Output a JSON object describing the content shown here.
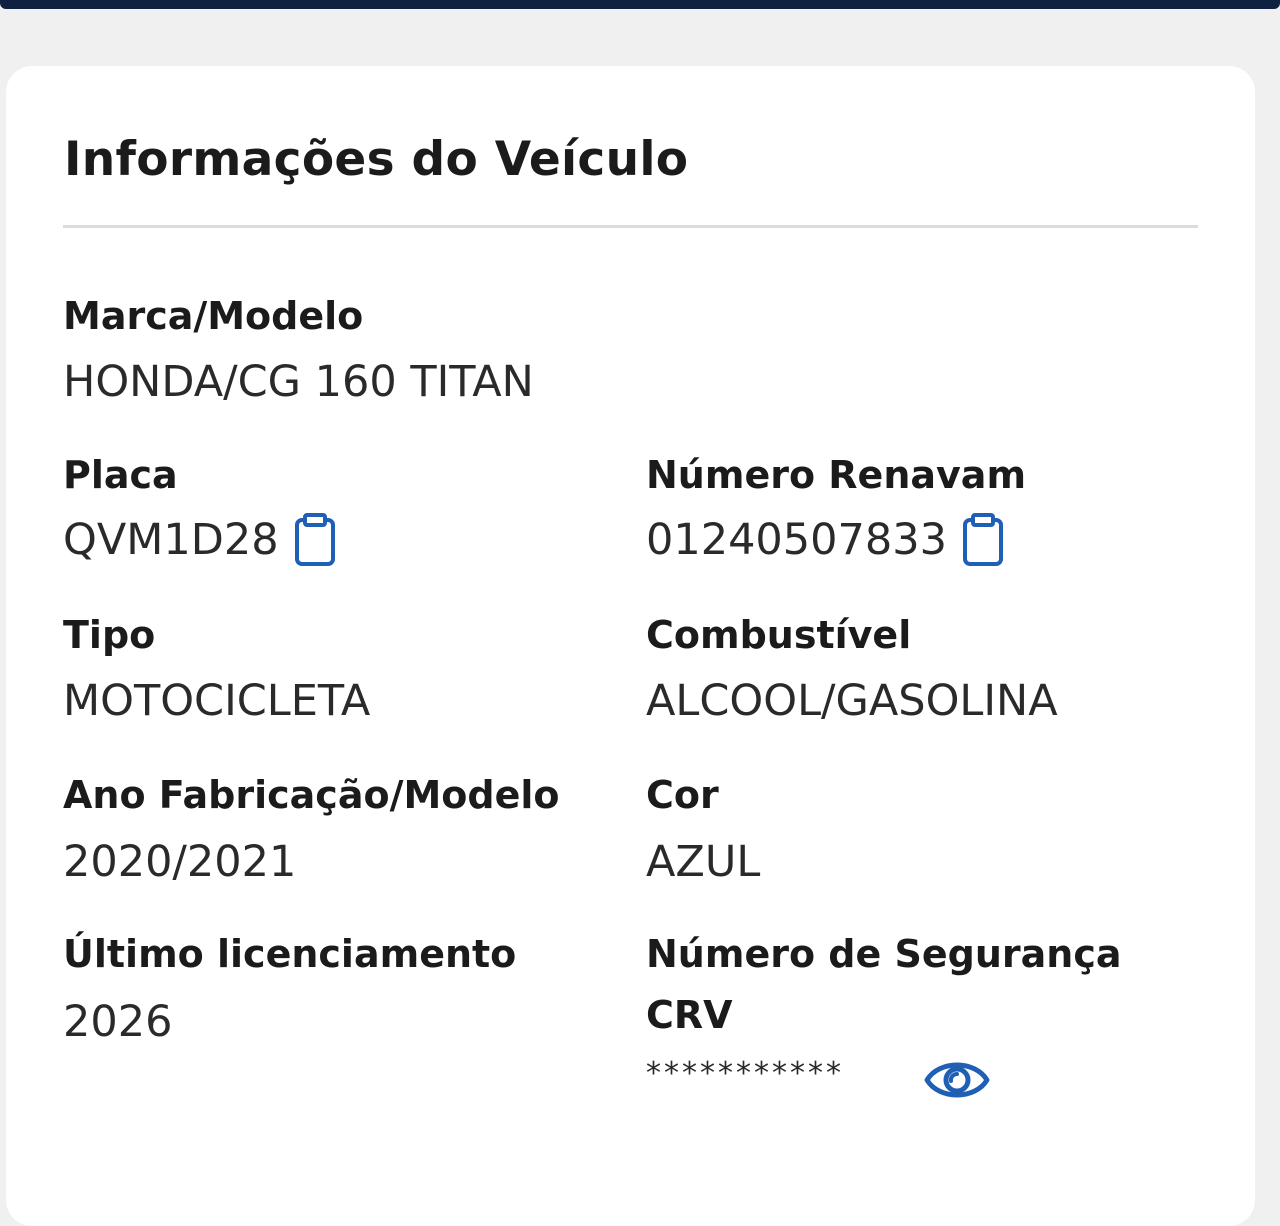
{
  "card": {
    "title": "Informações do Veículo"
  },
  "fields": {
    "marca_modelo": {
      "label": "Marca/Modelo",
      "value": "HONDA/CG 160 TITAN"
    },
    "placa": {
      "label": "Placa",
      "value": "QVM1D28"
    },
    "renavam": {
      "label": "Número Renavam",
      "value": "01240507833"
    },
    "tipo": {
      "label": "Tipo",
      "value": "MOTOCICLETA"
    },
    "combustivel": {
      "label": "Combustível",
      "value": "ALCOOL/GASOLINA"
    },
    "ano": {
      "label": "Ano Fabricação/Modelo",
      "value": "2020/2021"
    },
    "cor": {
      "label": "Cor",
      "value": "AZUL"
    },
    "licenciamento": {
      "label": "Último licenciamento",
      "value": "2026"
    },
    "seguranca_crv": {
      "label_line1": "Número de Segurança",
      "label_line2": "CRV",
      "value": "***********"
    }
  },
  "icons": {
    "copy": "clipboard-icon",
    "reveal": "eye-icon"
  },
  "colors": {
    "accent": "#1f5fb4",
    "top_bar": "#0f2140",
    "text": "#1b1b1b",
    "background": "#f0f0f0"
  }
}
